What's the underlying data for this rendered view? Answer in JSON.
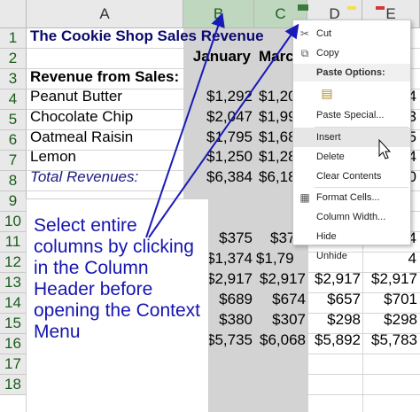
{
  "columns": [
    "A",
    "B",
    "C",
    "D",
    "E"
  ],
  "rows": [
    "1",
    "2",
    "3",
    "4",
    "5",
    "6",
    "7",
    "8",
    "9",
    "10",
    "11",
    "12",
    "13",
    "14",
    "15",
    "16",
    "17",
    "18"
  ],
  "sheet": {
    "title": "The Cookie Shop Sales Revenue",
    "month_b": "January",
    "month_c": "Marc",
    "revenue_label": "Revenue from Sales:",
    "items": [
      {
        "name": "Peanut Butter",
        "b": "$1,292",
        "c": "$1,20",
        "e": "4"
      },
      {
        "name": "Chocolate Chip",
        "b": "$2,047",
        "c": "$1,99",
        "e": "3"
      },
      {
        "name": "Oatmeal  Raisin",
        "b": "$1,795",
        "c": "$1,68",
        "e": "5"
      },
      {
        "name": "Lemon",
        "b": "$1,250",
        "c": "$1,28",
        "e": "4"
      }
    ],
    "total_label": "Total Revenues:",
    "total_b": "$6,384",
    "total_c": "$6,18",
    "total_e": "0",
    "lower": [
      {
        "b": "$375",
        "c": "$37",
        "d": "",
        "e": "4"
      },
      {
        "b": "$1,374",
        "c": "$1,79",
        "d": "",
        "e": "4"
      },
      {
        "b": "$2,917",
        "c": "$2,917",
        "d": "$2,917",
        "e": "$2,917"
      },
      {
        "b": "$689",
        "c": "$674",
        "d": "$657",
        "e": "$701"
      },
      {
        "b": "$380",
        "c": "$307",
        "d": "$298",
        "e": "$298"
      },
      {
        "b": "$5,735",
        "c": "$6,068",
        "d": "$5,892",
        "e": "$5,783"
      }
    ]
  },
  "callout": {
    "text": "Select entire columns by clicking in the Column Header before opening the Context Menu"
  },
  "context_menu": {
    "cut": "Cut",
    "copy": "Copy",
    "paste_options": "Paste Options:",
    "paste_special": "Paste Special...",
    "insert": "Insert",
    "delete": "Delete",
    "clear_contents": "Clear Contents",
    "format_cells": "Format Cells...",
    "column_width": "Column Width...",
    "hide": "Hide",
    "unhide": "Unhide"
  },
  "colors": {
    "selected_header": "#bfd6bf",
    "selected_column": "#d3d3d3",
    "callout_text": "#1515b0",
    "arrow": "#1a1ab8"
  }
}
